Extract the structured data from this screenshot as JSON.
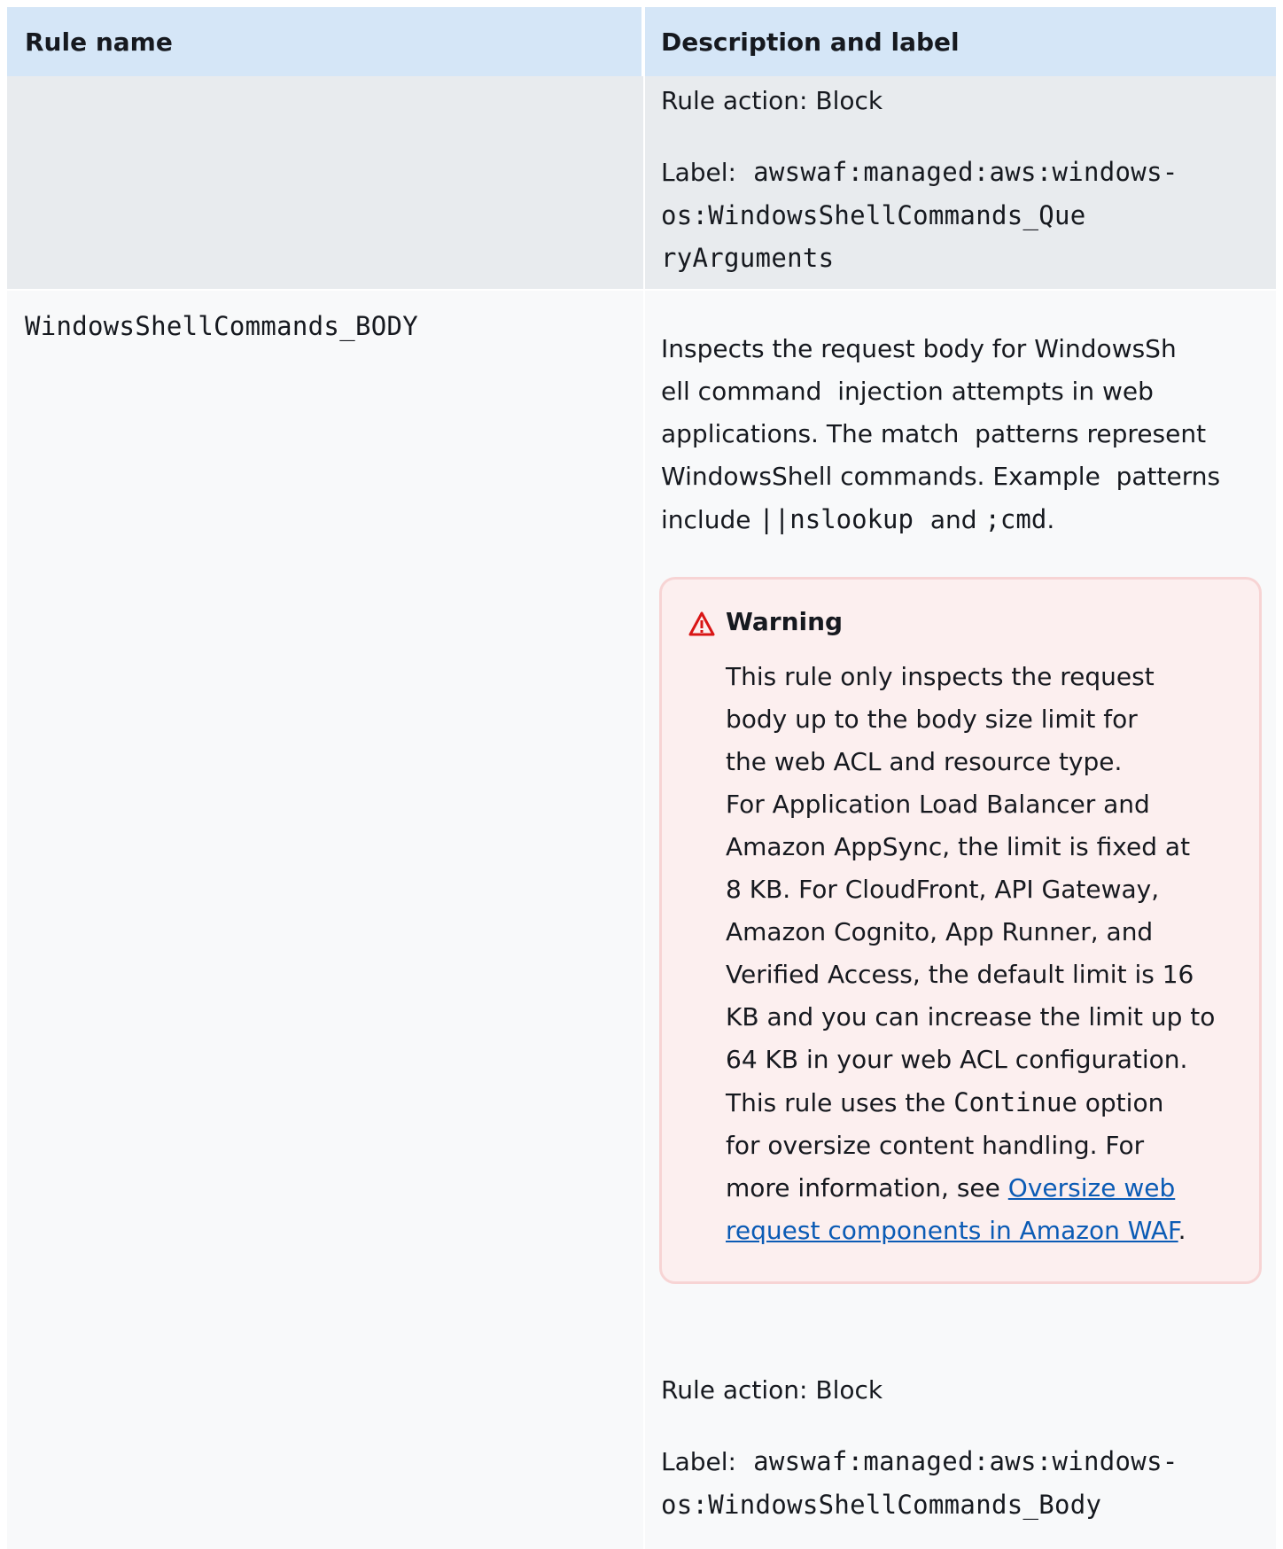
{
  "header": {
    "col1": "Rule name",
    "col2": "Description and label"
  },
  "row1": {
    "rule_action": "Rule action: Block",
    "label_prefix": "Label:",
    "label_lines": [
      "awswaf:managed:aws:windows-",
      "os:WindowsShellCommands_Que",
      "ryArguments"
    ]
  },
  "row2": {
    "rule_name": "WindowsShellCommands_BODY",
    "description": {
      "line1": "Inspects the request body for WindowsSh",
      "line2": "ell command  injection attempts in web",
      "line3": "applications. The match  patterns represent",
      "line4": "WindowsShell commands. Example  patterns",
      "line5_prefix": "include",
      "pattern1": "||nslookup",
      "and": "and",
      "pattern2": ";cmd",
      "period": "."
    },
    "warning": {
      "icon": "warning-triangle-icon",
      "title": "Warning",
      "lines": [
        "This rule only inspects the request",
        "body up to the body size limit for",
        "the web ACL and resource type.",
        "For Application Load Balancer and",
        "Amazon AppSync, the limit is fixed at",
        "8 KB. For CloudFront, API Gateway,",
        "Amazon Cognito, App Runner, and",
        "Verified Access, the default limit is 16",
        "KB and you can increase the limit up to",
        "64 KB in your web ACL configuration."
      ],
      "line11_prefix": "This rule uses the",
      "line11_code": "Continue",
      "line11_suffix": "option",
      "line12": "for oversize content handling. For",
      "line13_prefix": "more information, see",
      "link_part1": "Oversize web",
      "link_part2": "request components in Amazon WAF",
      "link_suffix": "."
    },
    "rule_action": "Rule action: Block",
    "label_prefix": "Label:",
    "label_lines": [
      "awswaf:managed:aws:windows-",
      "os:WindowsShellCommands_Body"
    ]
  },
  "colors": {
    "header_bg": "#d5e6f7",
    "row1_bg": "#e8ebee",
    "row2_bg": "#f8f9fa",
    "warning_bg": "#fcefef",
    "warning_border": "#f7d4d4",
    "warning_icon": "#d91515",
    "link": "#0b5bb5"
  }
}
